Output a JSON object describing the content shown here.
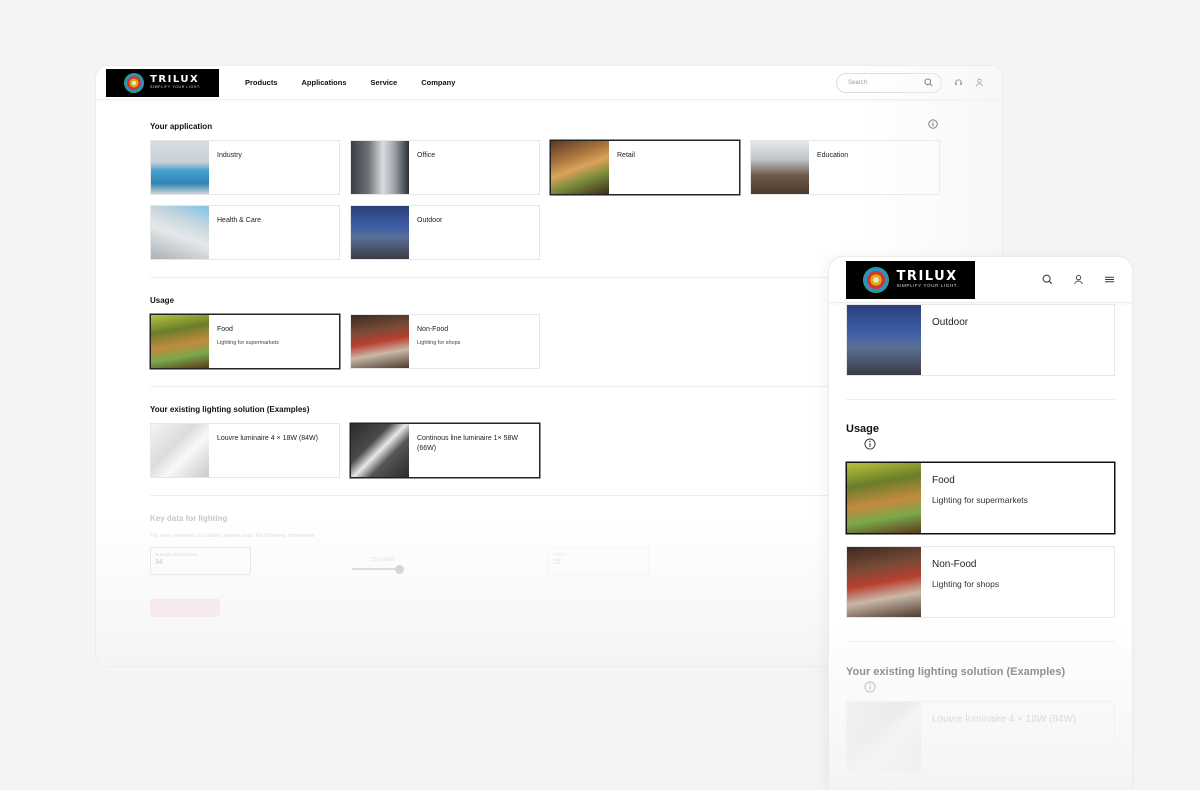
{
  "brand": {
    "name": "TRILUX",
    "tagline": "SIMPLIFY YOUR LIGHT."
  },
  "desktop": {
    "nav": [
      "Products",
      "Applications",
      "Service",
      "Company"
    ],
    "search_placeholder": "Search",
    "applications": {
      "title": "Your application",
      "items": [
        {
          "label": "Industry",
          "selected": false
        },
        {
          "label": "Office",
          "selected": false
        },
        {
          "label": "Retail",
          "selected": true
        },
        {
          "label": "Education",
          "selected": false
        },
        {
          "label": "Health & Care",
          "selected": false
        },
        {
          "label": "Outdoor",
          "selected": false
        }
      ]
    },
    "usage": {
      "title": "Usage",
      "items": [
        {
          "label": "Food",
          "sub": "Lighting for supermarkets",
          "selected": true
        },
        {
          "label": "Non-Food",
          "sub": "Lighting for shops",
          "selected": false
        }
      ]
    },
    "existing": {
      "title": "Your existing lighting solution (Examples)",
      "items": [
        {
          "label": "Louvre luminaire 4 × 18W (84W)",
          "selected": false
        },
        {
          "label": "Continous line luminaire 1× 58W (66W)",
          "selected": true
        }
      ]
    },
    "key_data": {
      "title": "Key data for lighting",
      "subtitle": "For your personal calculation, please enter the following information.",
      "luminaires_label": "Number of luminaires",
      "luminaires_value": "34",
      "price_label": "25 ct/kWh",
      "price_fraction": 1.0,
      "ct_label": "ct/kWh",
      "ct_value": "25"
    }
  },
  "mobile": {
    "outdoor": {
      "label": "Outdoor"
    },
    "usage": {
      "title": "Usage",
      "items": [
        {
          "label": "Food",
          "sub": "Lighting for supermarkets",
          "selected": true
        },
        {
          "label": "Non-Food",
          "sub": "Lighting for shops",
          "selected": false
        }
      ]
    },
    "existing": {
      "title": "Your existing lighting solution (Examples)",
      "first_item": "Louvre luminaire 4 × 18W (84W)"
    }
  },
  "colors": {
    "accent_selected": "#111111",
    "cta": "#e57373"
  }
}
